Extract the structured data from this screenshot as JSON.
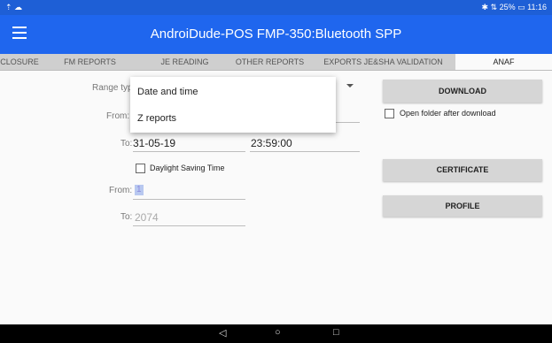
{
  "status_bar": {
    "left_icons": "⇡ ☁",
    "right_text": "✱ ⇅ 25% ▭ 11:16"
  },
  "app_bar": {
    "title": "AndroiDude-POS   FMP-350:Bluetooth SPP"
  },
  "tabs": [
    {
      "label": "CLOSURE"
    },
    {
      "label": "FM REPORTS"
    },
    {
      "label": "JE READING"
    },
    {
      "label": "OTHER REPORTS"
    },
    {
      "label": "EXPORTS JE&SHA VALIDATION"
    },
    {
      "label": "ANAF"
    }
  ],
  "form": {
    "range_type_label": "Range type",
    "from_label": "From:",
    "to_label": "To:",
    "to_date": "31-05-19",
    "to_time": "23:59:00",
    "dst_label": "Daylight Saving Time",
    "z_from_label": "From:",
    "z_from_value": "1",
    "z_to_label": "To:",
    "z_to_value": "2074"
  },
  "popup": {
    "options": [
      "Date and time",
      "Z reports"
    ]
  },
  "right_panel": {
    "download_label": "DOWNLOAD",
    "open_folder_label": "Open folder after download",
    "certificate_label": "CERTIFICATE",
    "profile_label": "PROFILE"
  },
  "nav_bar": {
    "back": "◁",
    "home": "○",
    "recents": "□"
  },
  "colors": {
    "status_bar": "#1e5fd6",
    "app_bar": "#1f66ee",
    "tabs_bg": "#cfcfcf",
    "button_bg": "#d6d6d6"
  }
}
